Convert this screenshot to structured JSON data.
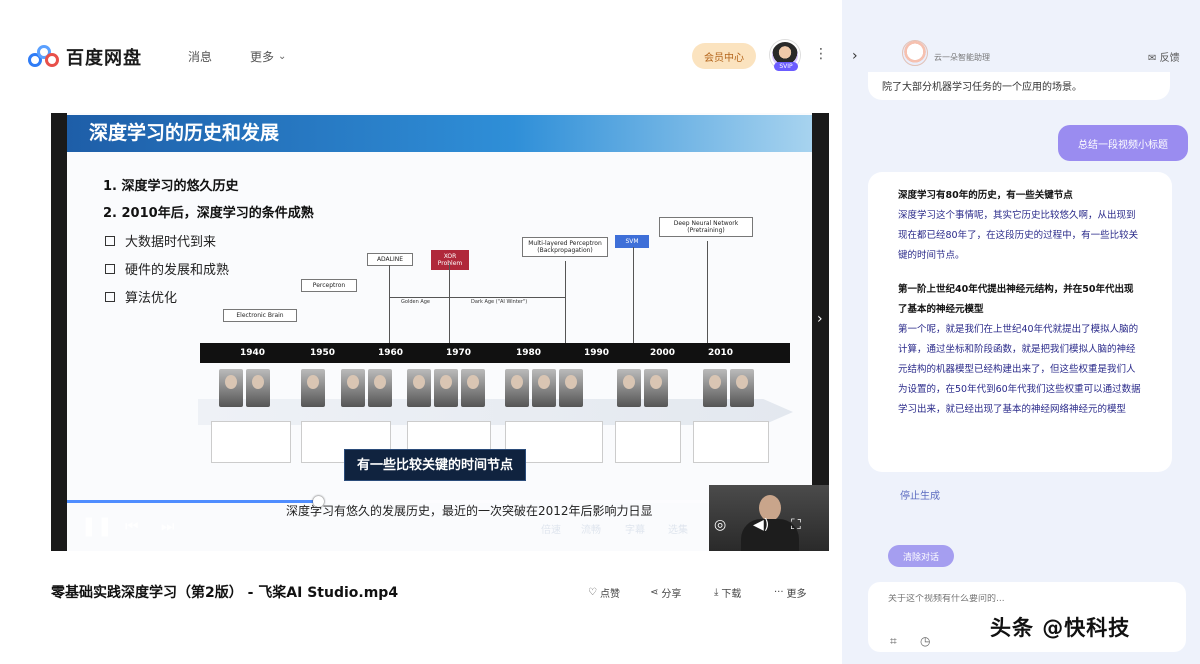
{
  "header": {
    "logo_text": "百度网盘",
    "nav": {
      "messages": "消息",
      "more": "更多"
    },
    "vip_label": "会员中心",
    "avatar_tag": "SVIP"
  },
  "player": {
    "slide": {
      "title": "深度学习的历史和发展",
      "headings": [
        "1. 深度学习的悠久历史",
        "2. 2010年后，深度学习的条件成熟"
      ],
      "bullets": [
        "大数据时代到来",
        "硬件的发展和成熟",
        "算法优化"
      ],
      "years": [
        "1940",
        "1950",
        "1960",
        "1970",
        "1980",
        "1990",
        "2000",
        "2010"
      ],
      "boxes": {
        "electronic_brain": "Electronic Brain",
        "perceptron": "Perceptron",
        "adaline": "ADALINE",
        "xor": "XOR Problem",
        "mlp": "Multi-layered Perceptron (Backpropagation)",
        "svm": "SVM",
        "dnn": "Deep Neural Network (Pretraining)"
      },
      "spans": {
        "golden": "Golden Age",
        "dark": "Dark Age (\"AI Winter\")"
      }
    },
    "subtitle_highlight": "有一些比较关键的时间节点",
    "caption": "深度学习有悠久的发展历史，最近的一次突破在2012年后影响力日显",
    "progress_fraction": 0.38,
    "controls": {
      "speed": "倍速",
      "quality": "流畅",
      "subtitles": "字幕",
      "episodes": "选集"
    }
  },
  "file": {
    "title": "零基础实践深度学习（第2版） - 飞桨AI Studio.mp4",
    "actions": {
      "like": "点赞",
      "share": "分享",
      "download": "下载",
      "more": "更多"
    }
  },
  "assistant": {
    "bot_name": "云一朵智能助理",
    "tool_label": "反馈",
    "prev_message": "院了大部分机器学习任务的一个应用的场景。",
    "user_message": "总结一段视频小标题",
    "answer": {
      "s1_title": "深度学习有80年的历史，有一些关键节点",
      "s1_body": "深度学习这个事情呢，其实它历史比较悠久啊，从出现到现在都已经80年了，在这段历史的过程中，有一些比较关键的时间节点。",
      "s2_title": "第一阶上世纪40年代提出神经元结构，并在50年代出现了基本的神经元模型",
      "s2_body": "第一个呢，就是我们在上世纪40年代就提出了模拟人脑的计算，通过坐标和阶段函数，就是把我们模拟人脑的神经元结构的机器模型已经构建出来了，但这些权重是我们人为设置的，在50年代到60年代我们这些权重可以通过数据学习出来，就已经出现了基本的神经网络神经元的模型"
    },
    "stop_label": "停止生成",
    "clear_label": "清除对话",
    "input_placeholder": "关于这个视频有什么要问的..."
  },
  "watermark": "头条 @快科技"
}
